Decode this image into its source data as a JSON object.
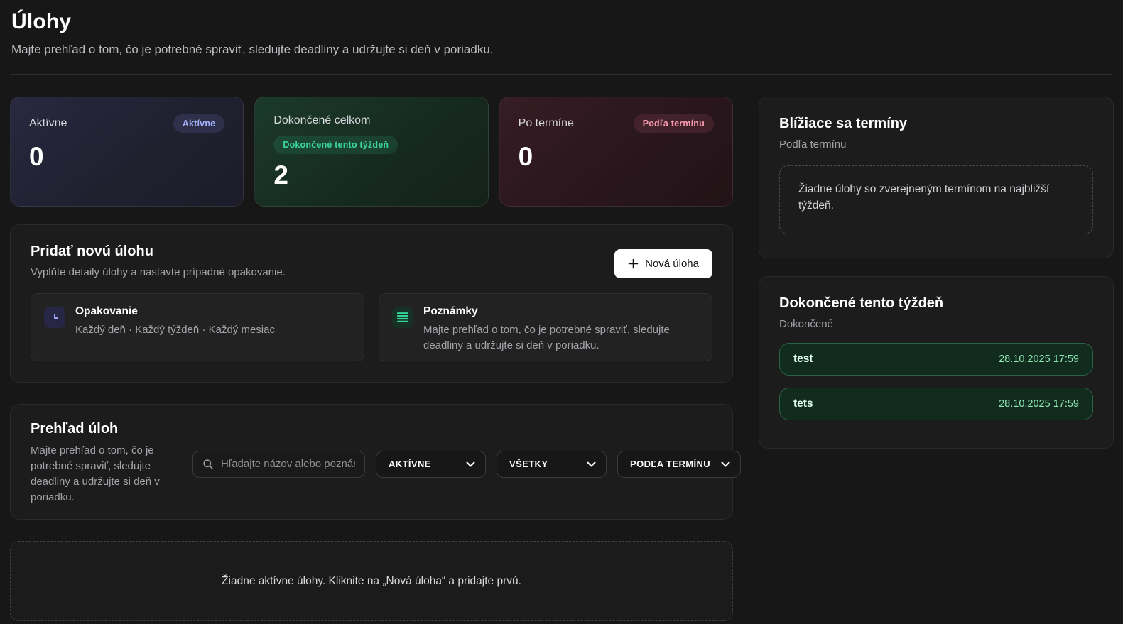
{
  "page": {
    "title": "Úlohy",
    "subtitle": "Majte prehľad o tom, čo je potrebné spraviť, sledujte deadliny a udržujte si deň v poriadku."
  },
  "stats": [
    {
      "label": "Aktívne",
      "badge": "Aktívne",
      "value": "0"
    },
    {
      "label": "Dokončené celkom",
      "badge": "Dokončené tento týždeň",
      "value": "2"
    },
    {
      "label": "Po termíne",
      "badge": "Podľa termínu",
      "value": "0"
    }
  ],
  "add_task": {
    "title": "Pridať novú úlohu",
    "subtitle": "Vyplňte detaily úlohy a nastavte prípadné opakovanie.",
    "button_label": "Nová úloha",
    "features": [
      {
        "icon": "clock-icon",
        "title": "Opakovanie",
        "text": "Každý deň · Každý týždeň · Každý mesiac"
      },
      {
        "icon": "list-icon",
        "title": "Poznámky",
        "text": "Majte prehľad o tom, čo je potrebné spraviť, sledujte deadliny a udržujte si deň v poriadku."
      }
    ]
  },
  "overview": {
    "title": "Prehľad úloh",
    "subtitle": "Majte prehľad o tom, čo je potrebné spraviť, sledujte deadliny a udržujte si deň v poriadku.",
    "search_placeholder": "Hľadajte názov alebo poznámku",
    "filters": [
      {
        "name": "status",
        "value": "AKTÍVNE"
      },
      {
        "name": "type",
        "value": "VŠETKY"
      },
      {
        "name": "sort",
        "value": "PODĽA TERMÍNU"
      }
    ],
    "empty_message": "Žiadne aktívne úlohy. Kliknite na „Nová úloha“ a pridajte prvú."
  },
  "upcoming": {
    "title": "Blížiace sa termíny",
    "subtitle": "Podľa termínu",
    "empty_message": "Žiadne úlohy so zverejneným termínom na najbližší týždeň."
  },
  "completed": {
    "title": "Dokončené tento týždeň",
    "subtitle": "Dokončené",
    "tasks": [
      {
        "name": "test",
        "datetime": "28.10.2025 17:59"
      },
      {
        "name": "tets",
        "datetime": "28.10.2025 17:59"
      }
    ]
  },
  "colors": {
    "accent_indigo": "#a5b0fa",
    "accent_green": "#34d399",
    "accent_rose": "#f999ad",
    "task_row_bg": "#112c1e",
    "task_row_border": "#2b6345",
    "panel_bg": "#1c1c1c",
    "page_bg": "#171717"
  }
}
